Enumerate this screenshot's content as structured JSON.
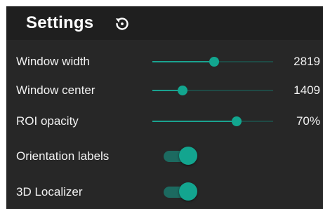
{
  "panel": {
    "title": "Settings",
    "reset_icon": "reset-rotate-icon"
  },
  "sliders": [
    {
      "label": "Window width",
      "value": "2819",
      "fraction": 0.51
    },
    {
      "label": "Window center",
      "value": "1409",
      "fraction": 0.25
    },
    {
      "label": "ROI opacity",
      "value": "70%",
      "fraction": 0.7
    }
  ],
  "toggles": [
    {
      "label": "Orientation labels",
      "on": true
    },
    {
      "label": "3D Localizer",
      "on": true
    }
  ],
  "colors": {
    "panel_bg": "#272727",
    "header_bg": "#1f1f1f",
    "accent": "#12a68f",
    "track": "#1f4a45",
    "toggle_track": "#1c6a60"
  }
}
